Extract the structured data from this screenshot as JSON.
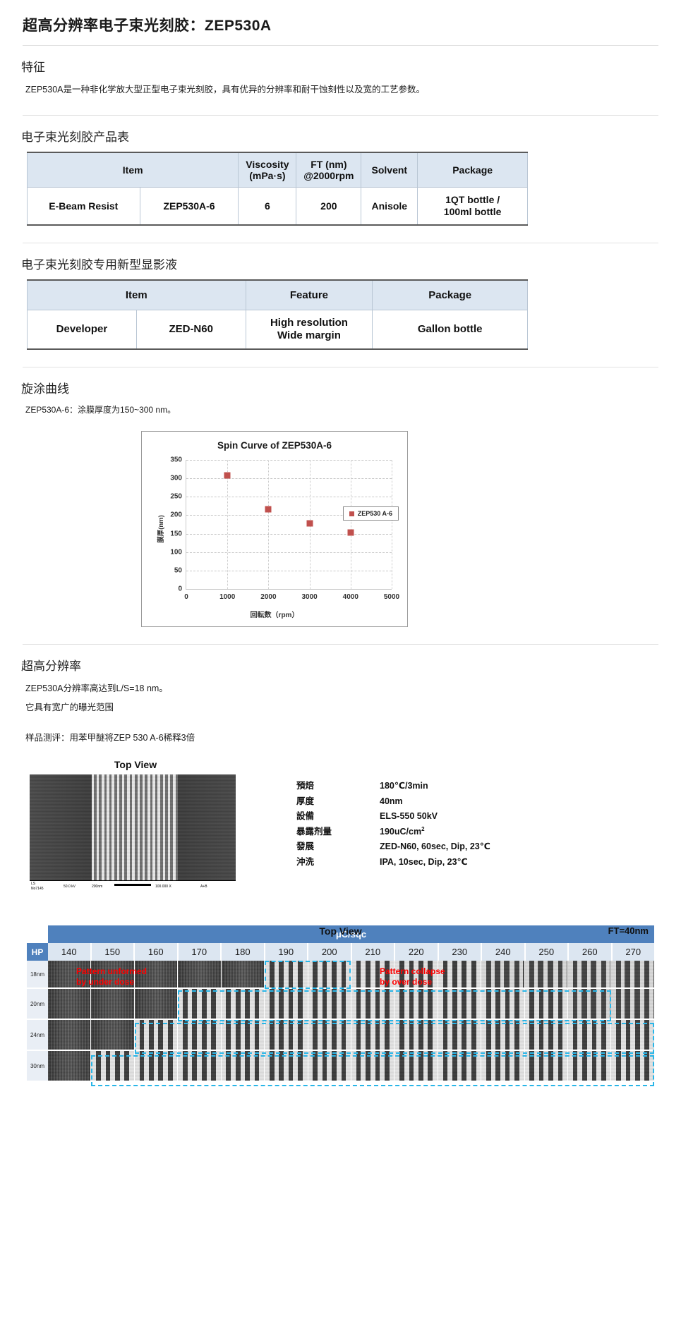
{
  "doc": {
    "title": "超高分辨率电子束光刻胶：ZEP530A"
  },
  "features": {
    "heading": "特征",
    "text": "ZEP530A是一种非化学放大型正型电子束光刻胶，具有优异的分辨率和耐干蚀刻性以及宽的工艺参数。"
  },
  "product_table": {
    "heading": "电子束光刻胶产品表",
    "headers": [
      "Item",
      "Viscosity\n(mPa·s)",
      "FT (nm)\n@2000rpm",
      "Solvent",
      "Package"
    ],
    "header_item": "Item",
    "header_viscosity_l1": "Viscosity",
    "header_viscosity_l2": "(mPa·s)",
    "header_ft_l1": "FT (nm)",
    "header_ft_l2": "@2000rpm",
    "header_solvent": "Solvent",
    "header_package": "Package",
    "row": {
      "item_type": "E-Beam Resist",
      "item_name": "ZEP530A-6",
      "viscosity": "6",
      "ft": "200",
      "solvent": "Anisole",
      "package_l1": "1QT bottle /",
      "package_l2": "100ml bottle"
    }
  },
  "developer_table": {
    "heading": "电子束光刻胶专用新型显影液",
    "header_item": "Item",
    "header_feature": "Feature",
    "header_package": "Package",
    "row": {
      "item_type": "Developer",
      "item_name": "ZED-N60",
      "feature_l1": "High resolution",
      "feature_l2": "Wide margin",
      "package": "Gallon bottle"
    }
  },
  "spin": {
    "heading": "旋涂曲线",
    "note": "ZEP530A-6：涂膜厚度为150~300 nm。"
  },
  "chart_data": {
    "type": "scatter",
    "title": "Spin Curve of ZEP530A-6",
    "xlabel": "回転数（rpm）",
    "ylabel": "膜厚(nm)",
    "xlim": [
      0,
      5000
    ],
    "ylim": [
      0,
      350
    ],
    "xticks": [
      "0",
      "1000",
      "2000",
      "3000",
      "4000",
      "5000"
    ],
    "yticks": [
      "0",
      "50",
      "100",
      "150",
      "200",
      "250",
      "300",
      "350"
    ],
    "grid": true,
    "legend_position": "right",
    "series": [
      {
        "name": "ZEP530 A-6",
        "color": "#c0504d",
        "x": [
          1000,
          2000,
          3000,
          4000
        ],
        "y": [
          308,
          216,
          178,
          153
        ]
      }
    ]
  },
  "resolution": {
    "heading": "超高分辨率",
    "line1": "ZEP530A分辨率高达到L/S=18 nm。",
    "line2": "它具有宽广的曝光范围",
    "sample_note": "样品测评：用苯甲醚将ZEP 530 A-6稀释3倍"
  },
  "sem": {
    "title": "Top View",
    "scalebar_left_l1": "LS",
    "scalebar_left_l2": "No7145",
    "scalebar_kv": "50.0 kV",
    "scalebar_len": "200nm",
    "scalebar_mag": "100.000 X",
    "scalebar_det": "A+B",
    "params": [
      {
        "key": "預焙",
        "value": "180℃/3min"
      },
      {
        "key": "厚度",
        "value": "40nm"
      },
      {
        "key": "設備",
        "value": "ELS-550 50kV"
      },
      {
        "key": "暴露剂量",
        "value": "190uC/cm",
        "sup": "2"
      },
      {
        "key": "發展",
        "value": "ZED-N60, 60sec, Dip, 23℃"
      },
      {
        "key": "沖洗",
        "value": "IPA, 10sec, Dip, 23℃"
      }
    ]
  },
  "matrix": {
    "title": "Top View",
    "ft_label": "FT=40nm",
    "banner": "μC/sqc",
    "hp_label": "HP",
    "doses": [
      "140",
      "150",
      "160",
      "170",
      "180",
      "190",
      "200",
      "210",
      "220",
      "230",
      "240",
      "250",
      "260",
      "270"
    ],
    "rows": [
      "18nm",
      "20nm",
      "24nm",
      "30nm"
    ],
    "annotations": {
      "under_l1": "Pattern  unformed",
      "under_l2": "by  under  dose",
      "over_l1": "Pattern   collapse",
      "over_l2": "by   over  dose"
    },
    "accent_color": "#4f81bd",
    "dash_color": "#29b6e8",
    "annot_color": "#ff0000"
  }
}
